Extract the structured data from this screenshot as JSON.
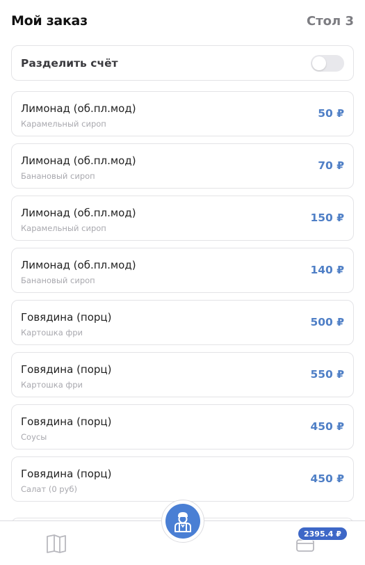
{
  "header": {
    "title": "Мой заказ",
    "table": "Стол 3"
  },
  "split_bill": {
    "label": "Разделить счёт",
    "enabled": false
  },
  "order_items": [
    {
      "name": "Лимонад (об.пл.мод)",
      "modifier": "Карамельный сироп",
      "price": "50 ₽"
    },
    {
      "name": "Лимонад (об.пл.мод)",
      "modifier": "Банановый сироп",
      "price": "70 ₽"
    },
    {
      "name": "Лимонад (об.пл.мод)",
      "modifier": "Карамельный сироп",
      "price": "150 ₽"
    },
    {
      "name": "Лимонад (об.пл.мод)",
      "modifier": "Банановый сироп",
      "price": "140 ₽"
    },
    {
      "name": "Говядина (порц)",
      "modifier": "Картошка фри",
      "price": "500 ₽"
    },
    {
      "name": "Говядина (порц)",
      "modifier": "Картошка фри",
      "price": "550 ₽"
    },
    {
      "name": "Говядина (порц)",
      "modifier": "Соусы",
      "price": "450 ₽"
    },
    {
      "name": "Говядина (порц)",
      "modifier": "Салат (0 руб)",
      "price": "450 ₽"
    }
  ],
  "bottom_nav": {
    "menu_icon": "book-icon",
    "waiter_icon": "waiter-icon",
    "payment_icon": "card-icon",
    "total_badge": "2395.4 ₽"
  },
  "colors": {
    "accent": "#4f7fc6",
    "waiter_button": "#4a7fd4",
    "badge": "#3d67c7"
  }
}
